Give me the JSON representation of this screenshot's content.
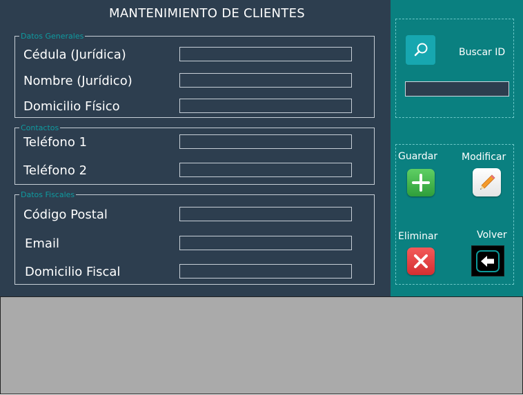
{
  "form": {
    "title": "MANTENIMIENTO DE CLIENTES",
    "groups": {
      "general": {
        "legend": "Datos Generales",
        "fields": [
          {
            "label": "Cédula (Jurídica)",
            "value": ""
          },
          {
            "label": "Nombre (Jurídico)",
            "value": ""
          },
          {
            "label": "Domicilio Físico",
            "value": ""
          }
        ]
      },
      "contacts": {
        "legend": "Contactos",
        "fields": [
          {
            "label": "Teléfono 1",
            "value": ""
          },
          {
            "label": "Teléfono 2",
            "value": ""
          }
        ]
      },
      "fiscal": {
        "legend": "Datos Fiscales",
        "fields": [
          {
            "label": "Código Postal",
            "value": ""
          },
          {
            "label": "Email",
            "value": ""
          },
          {
            "label": "Domicilio Fiscal",
            "value": ""
          }
        ]
      }
    }
  },
  "search": {
    "label": "Buscar ID",
    "value": "",
    "icon": "search-icon"
  },
  "actions": {
    "save": {
      "label": "Guardar",
      "icon": "plus-icon",
      "color": "#3fae49"
    },
    "modify": {
      "label": "Modificar",
      "icon": "pencil-icon",
      "color": "#f08a24"
    },
    "delete": {
      "label": "Eliminar",
      "icon": "x-icon",
      "color": "#e5383b"
    },
    "back": {
      "label": "Volver",
      "icon": "back-arrow-icon",
      "color": "#000000"
    }
  },
  "colors": {
    "form_bg": "#2d3e4f",
    "side_bg": "#0a8080",
    "legend": "#0f9ba0",
    "bottom_bg": "#aaaaaa"
  }
}
